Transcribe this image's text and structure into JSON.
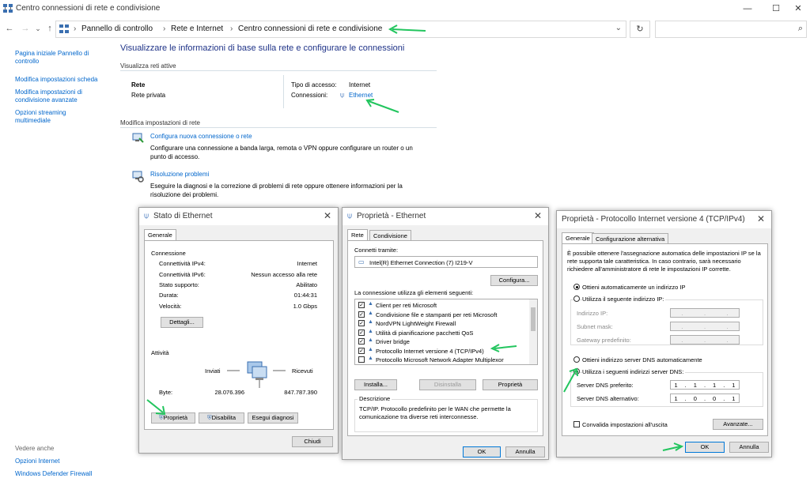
{
  "window": {
    "title": "Centro connessioni di rete e condivisione",
    "minimize": "—",
    "maximize": "☐",
    "close": "✕"
  },
  "address": {
    "back": "←",
    "forward": "→",
    "recent": "⌄",
    "up": "↑",
    "breadcrumbs": [
      "Pannello di controllo",
      "Rete e Internet",
      "Centro connessioni di rete e condivisione"
    ],
    "separator": "›",
    "dropdown": "⌄",
    "refresh": "↻",
    "search_placeholder": "",
    "search_icon": "⌕"
  },
  "sidebar": {
    "items": [
      "Pagina iniziale Pannello di controllo",
      "Modifica impostazioni scheda",
      "Modifica impostazioni di condivisione avanzate",
      "Opzioni streaming multimediale"
    ],
    "see_also": "Vedere anche",
    "see_also_items": [
      "Opzioni Internet",
      "Windows Defender Firewall"
    ]
  },
  "main": {
    "heading": "Visualizzare le informazioni di base sulla rete e configurare le connessioni",
    "active_networks": "Visualizza reti attive",
    "network_name": "Rete",
    "network_type": "Rete privata",
    "access_type_label": "Tipo di accesso:",
    "access_type_value": "Internet",
    "connections_label": "Connessioni:",
    "connections_value": "Ethernet",
    "modify_settings": "Modifica impostazioni di rete",
    "task1_title": "Configura nuova connessione o rete",
    "task1_desc": "Configurare una connessione a banda larga, remota o VPN oppure configurare un router o un punto di accesso.",
    "task2_title": "Risoluzione problemi",
    "task2_desc": "Eseguire la diagnosi e la correzione di problemi di rete oppure ottenere informazioni per la risoluzione dei problemi."
  },
  "status_dialog": {
    "title": "Stato di Ethernet",
    "tab": "Generale",
    "connection_header": "Connessione",
    "rows": [
      {
        "label": "Connettività IPv4:",
        "value": "Internet"
      },
      {
        "label": "Connettività IPv6:",
        "value": "Nessun accesso alla rete"
      },
      {
        "label": "Stato supporto:",
        "value": "Abilitato"
      },
      {
        "label": "Durata:",
        "value": "01:44:31"
      },
      {
        "label": "Velocità:",
        "value": "1.0 Gbps"
      }
    ],
    "details_button": "Dettagli...",
    "activity_header": "Attività",
    "sent_label": "Inviati",
    "received_label": "Ricevuti",
    "bytes_label": "Byte:",
    "bytes_sent": "28.076.396",
    "bytes_received": "847.787.390",
    "properties_button": "Proprietà",
    "disable_button": "Disabilita",
    "diagnose_button": "Esegui diagnosi",
    "close_button": "Chiudi"
  },
  "props_dialog": {
    "title": "Proprietà - Ethernet",
    "tabs": [
      "Rete",
      "Condivisione"
    ],
    "connect_using_label": "Connetti tramite:",
    "adapter": "Intel(R) Ethernet Connection (7) I219-V",
    "configure_button": "Configura...",
    "items_label": "La connessione utilizza gli elementi seguenti:",
    "items": [
      {
        "label": "Client per reti Microsoft",
        "checked": true
      },
      {
        "label": "Condivisione file e stampanti per reti Microsoft",
        "checked": true
      },
      {
        "label": "NordVPN LightWeight Firewall",
        "checked": true
      },
      {
        "label": "Utilità di pianificazione pacchetti QoS",
        "checked": true
      },
      {
        "label": "Driver bridge",
        "checked": true
      },
      {
        "label": "Protocollo Internet versione 4 (TCP/IPv4)",
        "checked": true
      },
      {
        "label": "Protocollo Microsoft Network Adapter Multiplexor",
        "checked": false
      }
    ],
    "install_button": "Installa...",
    "uninstall_button": "Disinstalla",
    "properties_button": "Proprietà",
    "description_header": "Descrizione",
    "description": "TCP/IP. Protocollo predefinito per le WAN che permette la comunicazione tra diverse reti interconnesse.",
    "ok_button": "OK",
    "cancel_button": "Annulla"
  },
  "ipv4_dialog": {
    "title": "Proprietà - Protocollo Internet versione 4 (TCP/IPv4)",
    "tabs": [
      "Generale",
      "Configurazione alternativa"
    ],
    "intro": "È possibile ottenere l'assegnazione automatica delle impostazioni IP se la rete supporta tale caratteristica. In caso contrario, sarà necessario richiedere all'amministratore di rete le impostazioni IP corrette.",
    "ip_auto": "Ottieni automaticamente un indirizzo IP",
    "ip_manual": "Utilizza il seguente indirizzo IP:",
    "ip_address_label": "Indirizzo IP:",
    "subnet_label": "Subnet mask:",
    "gateway_label": "Gateway predefinito:",
    "dns_auto": "Ottieni indirizzo server DNS automaticamente",
    "dns_manual": "Utilizza i seguenti indirizzi server DNS:",
    "dns_pref_label": "Server DNS preferito:",
    "dns_pref": [
      "1",
      "1",
      "1",
      "1"
    ],
    "dns_alt_label": "Server DNS alternativo:",
    "dns_alt": [
      "1",
      "0",
      "0",
      "1"
    ],
    "validate_label": "Convalida impostazioni all'uscita",
    "advanced_button": "Avanzate...",
    "ok_button": "OK",
    "cancel_button": "Annulla"
  },
  "colors": {
    "link": "#0066cc",
    "heading": "#1e3287",
    "annotation_arrow": "#22c55e"
  }
}
